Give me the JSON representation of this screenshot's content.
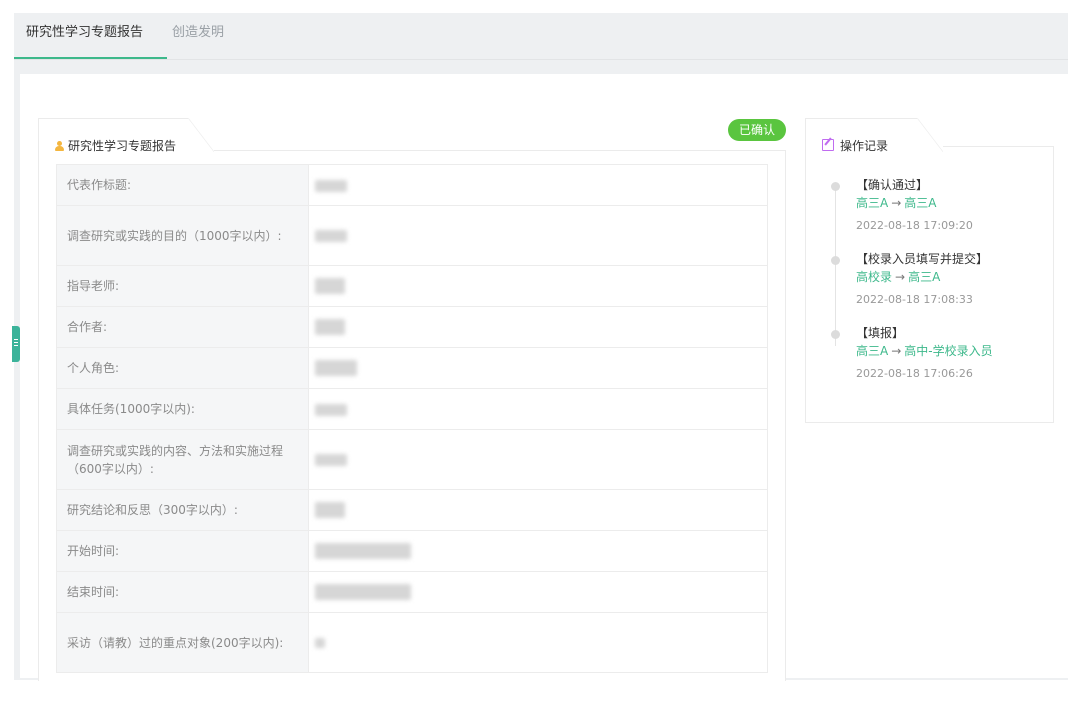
{
  "tabs": [
    {
      "label": "研究性学习专题报告",
      "active": true
    },
    {
      "label": "创造发明",
      "active": false
    }
  ],
  "status_badge": "已确认",
  "report_panel": {
    "title": "研究性学习专题报告",
    "icon": "user-icon",
    "fields": [
      {
        "label": "代表作标题:"
      },
      {
        "label": "调查研究或实践的目的（1000字以内）:"
      },
      {
        "label": "指导老师:"
      },
      {
        "label": "合作者:"
      },
      {
        "label": "个人角色:"
      },
      {
        "label": "具体任务(1000字以内):"
      },
      {
        "label": "调查研究或实践的内容、方法和实施过程（600字以内）:"
      },
      {
        "label": "研究结论和反思（300字以内）:"
      },
      {
        "label": "开始时间:"
      },
      {
        "label": "结束时间:"
      },
      {
        "label": "采访（请教）过的重点对象(200字以内):"
      }
    ]
  },
  "log_panel": {
    "title": "操作记录",
    "icon": "edit-icon",
    "entries": [
      {
        "action": "【确认通过】",
        "from": "高三A",
        "arrow": "→",
        "to": "高三A",
        "time": "2022-08-18 17:09:20"
      },
      {
        "action": "【校录入员填写并提交】",
        "from": "高校录",
        "arrow": "→",
        "to": "高三A",
        "time": "2022-08-18 17:08:33"
      },
      {
        "action": "【填报】",
        "from": "高三A",
        "arrow": "→",
        "to": "高中-学校录入员",
        "time": "2022-08-18 17:06:26"
      }
    ]
  },
  "colors": {
    "accent": "#3db88b",
    "badge": "#5ac53f",
    "label_bg": "#f5f6f7"
  }
}
